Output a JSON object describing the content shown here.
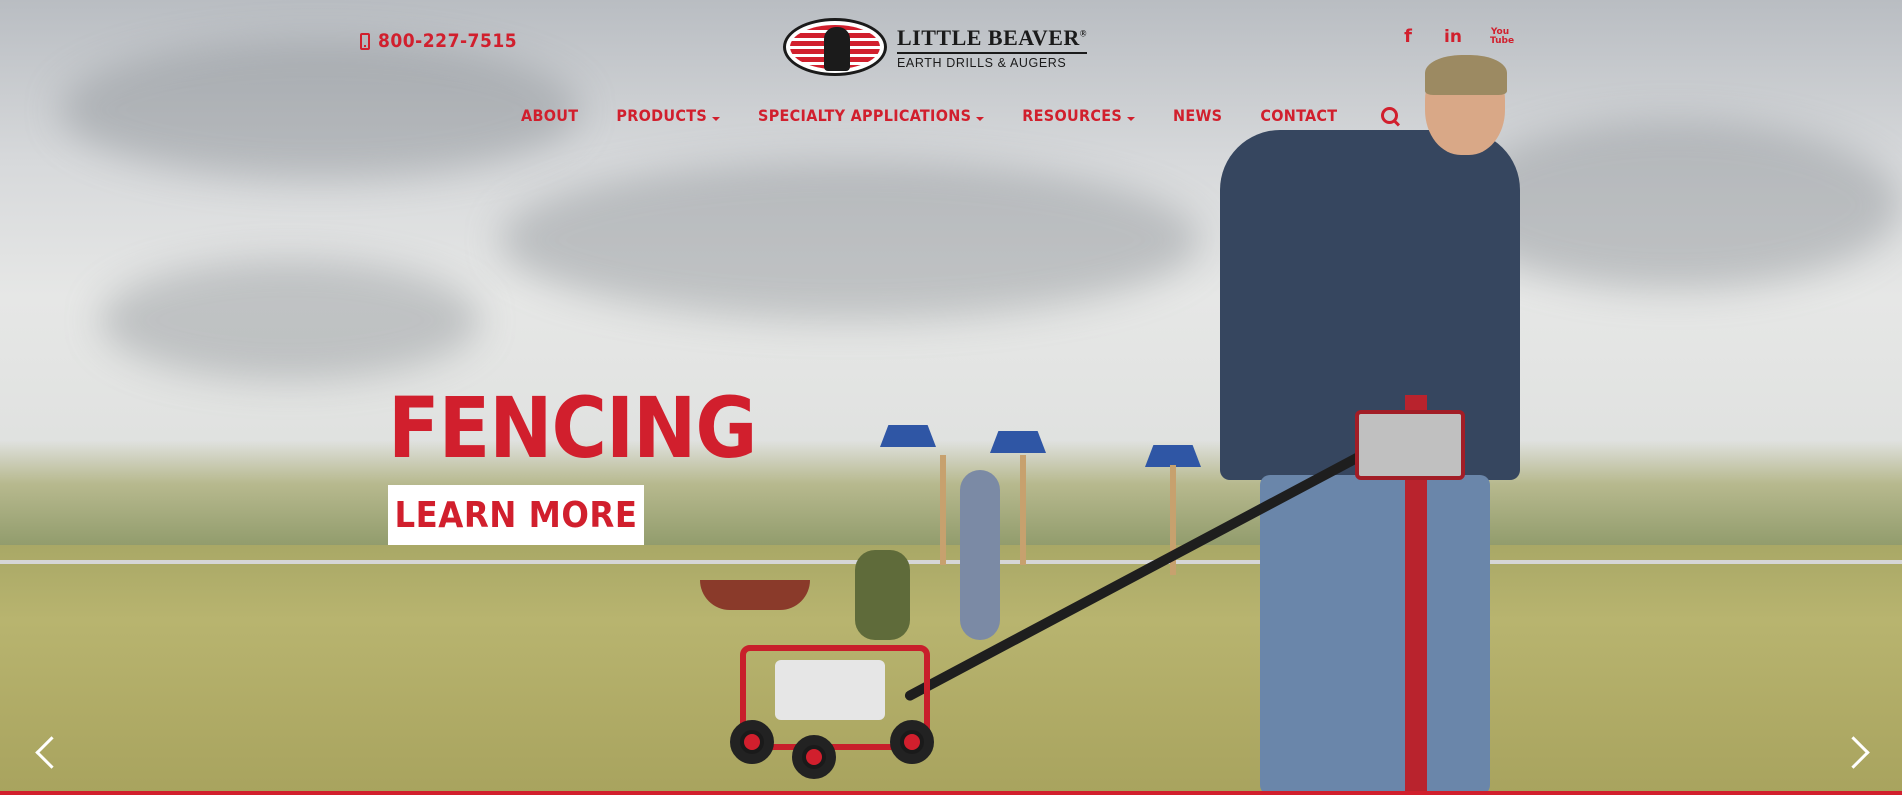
{
  "header": {
    "phone": "800-227-7515",
    "logo": {
      "title": "LITTLE BEAVER",
      "registered": "®",
      "subtitle": "EARTH DRILLS & AUGERS"
    },
    "social": {
      "facebook": "f",
      "linkedin": "in",
      "youtube_top": "You",
      "youtube_bottom": "Tube"
    }
  },
  "nav": {
    "items": [
      {
        "label": "About",
        "dropdown": false
      },
      {
        "label": "Products",
        "dropdown": true
      },
      {
        "label": "Specialty Applications",
        "dropdown": true
      },
      {
        "label": "Resources",
        "dropdown": true
      },
      {
        "label": "News",
        "dropdown": false
      },
      {
        "label": "Contact",
        "dropdown": false
      }
    ]
  },
  "slide": {
    "title": "FENCING",
    "cta": "LEARN MORE"
  },
  "colors": {
    "brand_red": "#d11f2d",
    "white": "#ffffff",
    "dark": "#1b1b1b"
  },
  "icons": {
    "phone": "phone-icon",
    "search": "search-icon",
    "prev": "chevron-left-icon",
    "next": "chevron-right-icon"
  }
}
